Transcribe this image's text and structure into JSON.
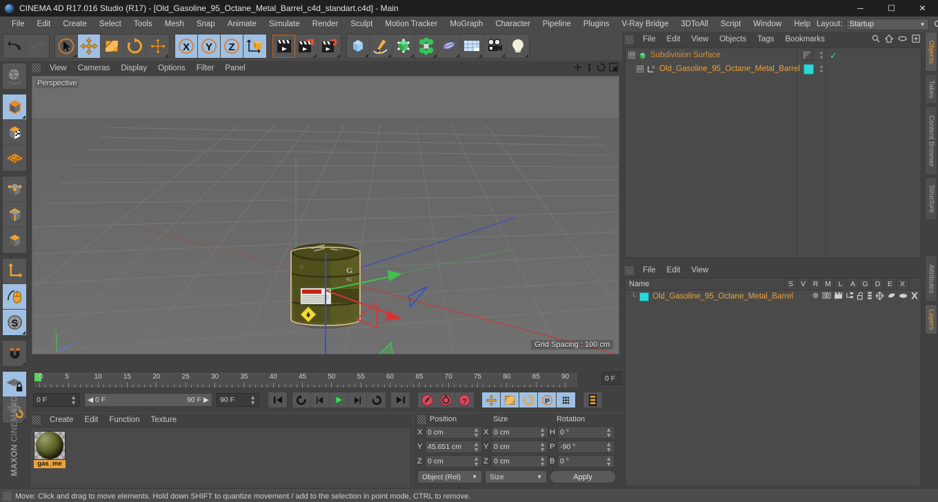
{
  "window": {
    "title": "CINEMA 4D R17.016 Studio (R17) - [Old_Gasoline_95_Octane_Metal_Barrel_c4d_standart.c4d] - Main",
    "app_icon": "c4d-logo-icon",
    "minimize": "─",
    "maximize": "☐",
    "close": "✕"
  },
  "menubar": {
    "items": [
      {
        "label": "File"
      },
      {
        "label": "Edit"
      },
      {
        "label": "Create"
      },
      {
        "label": "Select"
      },
      {
        "label": "Tools"
      },
      {
        "label": "Mesh"
      },
      {
        "label": "Snap"
      },
      {
        "label": "Animate"
      },
      {
        "label": "Simulate"
      },
      {
        "label": "Render"
      },
      {
        "label": "Sculpt"
      },
      {
        "label": "Motion Tracker"
      },
      {
        "label": "MoGraph"
      },
      {
        "label": "Character"
      },
      {
        "label": "Pipeline"
      },
      {
        "label": "Plugins"
      },
      {
        "label": "V-Ray Bridge"
      },
      {
        "label": "3DToAll"
      },
      {
        "label": "Script"
      },
      {
        "label": "Window"
      },
      {
        "label": "Help"
      }
    ],
    "layout_label": "Layout:",
    "layout_value": "Startup",
    "search_icon": "search-icon"
  },
  "toolbar": {
    "groups": [
      {
        "buttons": [
          {
            "name": "undo-button",
            "icon": "undo-arrow-icon",
            "selected": false,
            "corner": false
          },
          {
            "name": "redo-button",
            "icon": "redo-arrow-icon",
            "selected": false,
            "corner": false
          }
        ]
      },
      {
        "buttons": [
          {
            "name": "live-selection-tool",
            "icon": "cursor-circle-icon",
            "selected": false,
            "corner": true
          },
          {
            "name": "move-tool",
            "icon": "move-arrows-icon",
            "selected": true,
            "corner": false
          },
          {
            "name": "scale-tool",
            "icon": "scale-box-icon",
            "selected": false,
            "corner": false
          },
          {
            "name": "rotate-tool",
            "icon": "rotate-ring-icon",
            "selected": false,
            "corner": false
          },
          {
            "name": "move-duplicate-tool",
            "icon": "move-arrows-icon",
            "selected": false,
            "corner": true
          }
        ]
      },
      {
        "buttons": [
          {
            "name": "x-axis-lock",
            "icon": "x-axis-icon",
            "selected": true,
            "corner": false
          },
          {
            "name": "y-axis-lock",
            "icon": "y-axis-icon",
            "selected": true,
            "corner": false
          },
          {
            "name": "z-axis-lock",
            "icon": "z-axis-icon",
            "selected": true,
            "corner": false
          },
          {
            "name": "world-object-coordinates",
            "icon": "coordinate-cube-icon",
            "selected": false,
            "corner": false
          }
        ]
      },
      {
        "buttons": [
          {
            "name": "render-view-button",
            "icon": "clapperboard-icon",
            "selected": false,
            "corner": false
          },
          {
            "name": "render-to-picture-viewer-button",
            "icon": "clapperboard-picture-icon",
            "selected": false,
            "corner": true
          },
          {
            "name": "render-settings-button",
            "icon": "clapperboard-gear-icon",
            "selected": false,
            "corner": true
          }
        ]
      },
      {
        "buttons": [
          {
            "name": "add-cube-object",
            "icon": "blue-cube-icon",
            "selected": false,
            "corner": true
          },
          {
            "name": "add-spline-object",
            "icon": "pen-spline-icon",
            "selected": false,
            "corner": true
          },
          {
            "name": "add-generator-object",
            "icon": "green-cube-icon",
            "selected": false,
            "corner": true
          },
          {
            "name": "add-mograph-object",
            "icon": "green-cluster-icon",
            "selected": false,
            "corner": true
          },
          {
            "name": "add-deformer-object",
            "icon": "bend-deformer-icon",
            "selected": false,
            "corner": true
          },
          {
            "name": "add-environment-object",
            "icon": "floor-grid-icon",
            "selected": false,
            "corner": true
          },
          {
            "name": "add-camera-object",
            "icon": "camera-icon",
            "selected": false,
            "corner": true
          },
          {
            "name": "add-light-object",
            "icon": "light-bulb-icon",
            "selected": false,
            "corner": true
          }
        ]
      }
    ]
  },
  "lefttools": {
    "groups": [
      {
        "buttons": [
          {
            "name": "undo-view-button",
            "icon": "globe-wireframe-icon",
            "selected": false,
            "corner": false
          }
        ]
      },
      {
        "buttons": [
          {
            "name": "model-mode-button",
            "icon": "model-cube-icon",
            "selected": true,
            "corner": true
          },
          {
            "name": "texture-mode-button",
            "icon": "texture-cube-icon",
            "selected": false,
            "corner": false
          },
          {
            "name": "workplane-mode-button",
            "icon": "workplane-icon",
            "selected": false,
            "corner": false
          }
        ]
      },
      {
        "buttons": [
          {
            "name": "points-mode-button",
            "icon": "points-cube-icon",
            "selected": false,
            "corner": false
          },
          {
            "name": "edges-mode-button",
            "icon": "edges-cube-icon",
            "selected": false,
            "corner": false
          },
          {
            "name": "polygons-mode-button",
            "icon": "polygons-cube-icon",
            "selected": false,
            "corner": false
          }
        ]
      },
      {
        "buttons": [
          {
            "name": "enable-axis-modification-button",
            "icon": "axis-arrow-icon",
            "selected": false,
            "corner": false
          },
          {
            "name": "viewport-solo-button",
            "icon": "mouse-curve-icon",
            "selected": true,
            "corner": false
          },
          {
            "name": "enable-snapping-button",
            "icon": "s-circle-icon",
            "selected": true,
            "corner": true
          }
        ]
      },
      {
        "buttons": [
          {
            "name": "magnet-tool-button",
            "icon": "magnet-icon",
            "selected": false,
            "corner": true
          }
        ]
      },
      {
        "buttons": [
          {
            "name": "lock-workplane-button",
            "icon": "workplane-lock-icon",
            "selected": true,
            "corner": false
          },
          {
            "name": "planar-workplane-button",
            "icon": "workplane-rotate-icon",
            "selected": false,
            "corner": true
          }
        ]
      }
    ],
    "brand_bold": "MAXON",
    "brand_rest": " CINEMA 4D"
  },
  "viewport": {
    "menu": [
      {
        "label": "View"
      },
      {
        "label": "Cameras"
      },
      {
        "label": "Display"
      },
      {
        "label": "Options"
      },
      {
        "label": "Filter"
      },
      {
        "label": "Panel"
      }
    ],
    "header_icons": [
      {
        "name": "viewport-pan-icon"
      },
      {
        "name": "viewport-dolly-icon"
      },
      {
        "name": "viewport-rotate-icon"
      },
      {
        "name": "viewport-maximize-icon"
      }
    ],
    "perspective_label": "Perspective",
    "grid_spacing": "Grid Spacing : 100 cm",
    "axis_gizmo": {
      "y": "Y",
      "z": "Z",
      "x": "X"
    },
    "object_description": "Olive green metal gasoline barrel with danger label and yellow flammable diamond sticker"
  },
  "timeline": {
    "tick_labels": [
      "0",
      "5",
      "10",
      "15",
      "20",
      "25",
      "30",
      "35",
      "40",
      "45",
      "50",
      "55",
      "60",
      "65",
      "70",
      "75",
      "80",
      "85",
      "90"
    ],
    "current_frame_box": "0 F",
    "start_field": "0 F",
    "range_min": "0 F",
    "range_max": "90 F",
    "end_field": "90 F",
    "transport": [
      {
        "name": "go-to-start-button",
        "icon": "skip-start-icon"
      },
      {
        "name": "play-backwards-loop-button",
        "icon": "loop-back-icon"
      },
      {
        "name": "step-back-button",
        "icon": "step-back-icon"
      },
      {
        "name": "play-button",
        "icon": "play-icon"
      },
      {
        "name": "step-forward-button",
        "icon": "step-forward-icon"
      },
      {
        "name": "play-forward-loop-button",
        "icon": "loop-forward-icon"
      },
      {
        "name": "go-to-end-button",
        "icon": "skip-end-icon"
      }
    ],
    "record_group": [
      {
        "name": "record-active-objects-button",
        "icon": "record-key-icon"
      },
      {
        "name": "autokeying-button",
        "icon": "autokey-ring-icon"
      },
      {
        "name": "keyframe-selection-button",
        "icon": "question-ring-icon"
      }
    ],
    "keying_group": [
      {
        "name": "position-key-button",
        "icon": "move-arrows-icon"
      },
      {
        "name": "scale-key-button",
        "icon": "scale-box-icon"
      },
      {
        "name": "rotation-key-button",
        "icon": "rotate-ring-icon"
      },
      {
        "name": "parameter-key-button",
        "icon": "p-circle-icon"
      },
      {
        "name": "point-level-animation-button",
        "icon": "dots-grid-icon"
      }
    ],
    "extra_button": {
      "name": "timeline-view-toggle-button",
      "icon": "film-strip-icon"
    }
  },
  "material_manager": {
    "menu": [
      {
        "label": "Create"
      },
      {
        "label": "Edit"
      },
      {
        "label": "Function"
      },
      {
        "label": "Texture"
      }
    ],
    "materials": [
      {
        "name_label": "gas_me",
        "thumb": "olive-material-sphere"
      }
    ]
  },
  "coordinates": {
    "headers": [
      "Position",
      "Size",
      "Rotation"
    ],
    "rows": [
      {
        "pos_label": "X",
        "pos_value": "0 cm",
        "size_label": "X",
        "size_value": "0 cm",
        "rot_label": "H",
        "rot_value": "0 °"
      },
      {
        "pos_label": "Y",
        "pos_value": "45.651 cm",
        "size_label": "Y",
        "size_value": "0 cm",
        "rot_label": "P",
        "rot_value": "-90 °"
      },
      {
        "pos_label": "Z",
        "pos_value": "0 cm",
        "size_label": "Z",
        "size_value": "0 cm",
        "rot_label": "B",
        "rot_value": "0 °"
      }
    ],
    "mode_select": "Object (Rel)",
    "size_select": "Size",
    "apply_button": "Apply"
  },
  "objects_manager": {
    "tab_title": "Objects",
    "menu": [
      {
        "label": "File"
      },
      {
        "label": "Edit"
      },
      {
        "label": "View"
      },
      {
        "label": "Objects"
      },
      {
        "label": "Tags"
      },
      {
        "label": "Bookmarks"
      }
    ],
    "head_icons": [
      {
        "name": "search-icon"
      },
      {
        "name": "home-icon"
      },
      {
        "name": "ellipse-icon"
      },
      {
        "name": "add-panel-icon"
      }
    ],
    "rows": [
      {
        "name": "Subdivision Surface",
        "icon": "subdivision-surface-icon",
        "indent": 0,
        "tag": "display-tag",
        "check": "✓"
      },
      {
        "name": "Old_Gasoline_95_Octane_Metal_Barrel",
        "icon": "polygon-object-icon",
        "indent": 1,
        "swatch": "#2ad9d9"
      }
    ]
  },
  "attributes_manager": {
    "tab_title": "Attributes",
    "layers_tab_title": "Layers",
    "menu": [
      {
        "label": "File"
      },
      {
        "label": "Edit"
      },
      {
        "label": "View"
      }
    ],
    "columns": [
      "Name",
      "S",
      "V",
      "R",
      "M",
      "L",
      "A",
      "G",
      "D",
      "E",
      "X"
    ],
    "rows": [
      {
        "name": "Old_Gasoline_95_Octane_Metal_Barrel",
        "swatch": "#2ad9d9",
        "icons": [
          "solo-dot-icon",
          "visible-eye-icon",
          "render-clapper-icon",
          "manager-icon",
          "lock-open-icon",
          "animation-icon",
          "generator-icon",
          "deformer-icon",
          "expression-icon",
          "xref-icon"
        ]
      }
    ]
  },
  "right_tabs": [
    {
      "label": "Objects",
      "active": true,
      "h": 58
    },
    {
      "label": "Takes",
      "active": false,
      "h": 44
    },
    {
      "label": "Content Browser",
      "active": false,
      "h": 96
    },
    {
      "label": "Structure",
      "active": false,
      "h": 60
    },
    {
      "label": "Attributes",
      "active": false,
      "h": 66
    },
    {
      "label": "Layers",
      "active": true,
      "h": 44
    }
  ],
  "statusbar": {
    "message": "Move: Click and drag to move elements. Hold down SHIFT to quantize movement / add to the selection in point mode, CTRL to remove."
  },
  "colors": {
    "accent_orange": "#e8a33d",
    "selection_blue": "#9fc0e2",
    "cyan_swatch": "#2ad9d9",
    "panel_bg": "#414141",
    "viewport_bg": "#6a6a6a"
  }
}
